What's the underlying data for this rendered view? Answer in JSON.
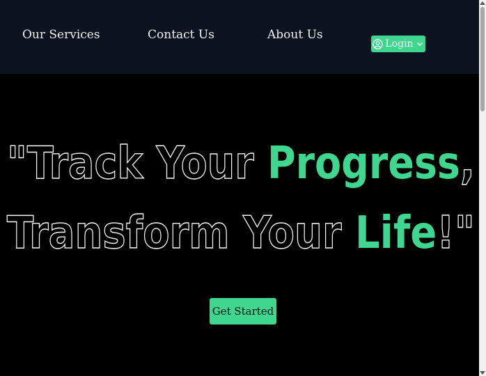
{
  "nav": {
    "services": "Our Services",
    "contact": "Contact Us",
    "about": "About Us",
    "login": "Login"
  },
  "hero": {
    "line1_plain": "\"Track Your ",
    "line1_accent": "Progress",
    "line1_end": ",",
    "line2_plain": "Transform Your ",
    "line2_accent": "Life",
    "line2_end": "!\"",
    "cta": "Get Started"
  },
  "icons": {
    "login_user": "user-circle-icon",
    "login_chevron": "chevron-down-icon"
  },
  "colors": {
    "nav_bg": "#0c1220",
    "page_bg": "#000000",
    "accent": "#3fd68f",
    "text": "#f2f2f2"
  }
}
